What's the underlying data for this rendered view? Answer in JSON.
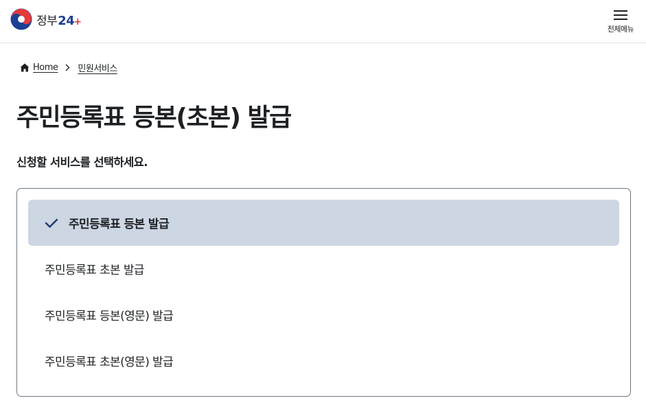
{
  "header": {
    "logo": {
      "text": "정부",
      "number": "24",
      "plus": "+",
      "colors": {
        "red": "#e23b3b",
        "blue": "#1c3f94"
      }
    },
    "menu": {
      "label": "전체메뉴",
      "icon": "hamburger-icon"
    }
  },
  "breadcrumb": {
    "home_icon": "home-icon",
    "home_label": "Home",
    "separator_icon": "chevron-right-icon",
    "current_label": "민원서비스"
  },
  "page": {
    "title": "주민등록표 등본(초본) 발급",
    "instruction": "신청할 서비스를 선택하세요."
  },
  "options": {
    "selected_index": 0,
    "check_icon": "check-icon",
    "items": [
      {
        "label": "주민등록표 등본 발급",
        "selected": true
      },
      {
        "label": "주민등록표 초본 발급",
        "selected": false
      },
      {
        "label": "주민등록표 등본(영문) 발급",
        "selected": false
      },
      {
        "label": "주민등록표 초본(영문) 발급",
        "selected": false
      }
    ]
  },
  "colors": {
    "selected_bg": "#cdd6e3",
    "border": "#6d7882",
    "text": "#1e2124",
    "check": "#1e3a6e"
  }
}
